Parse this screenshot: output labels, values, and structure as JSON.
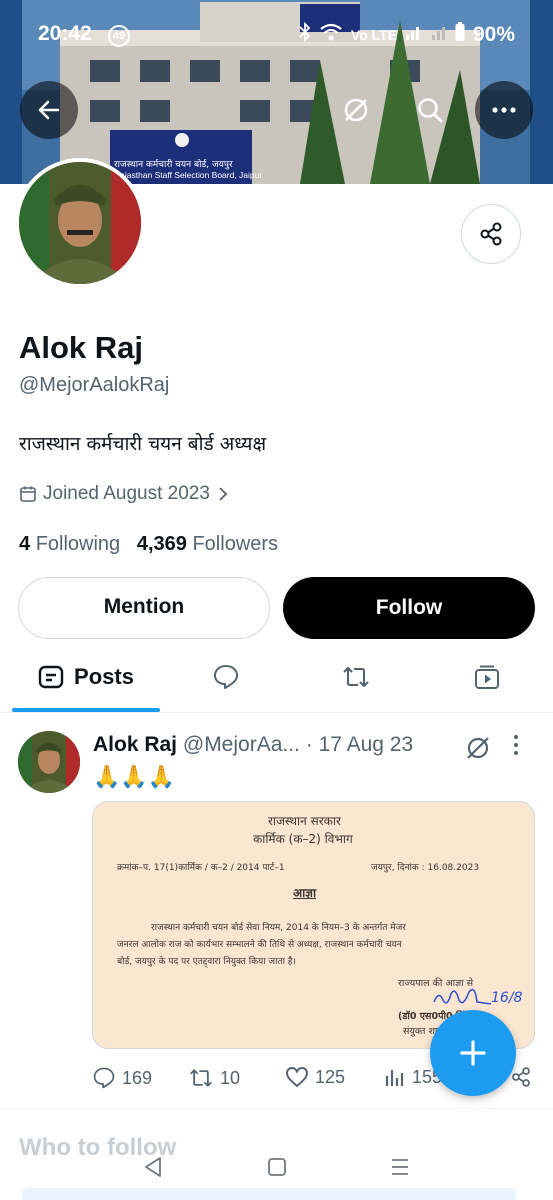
{
  "status_bar": {
    "time": "20:42",
    "notification_count": "49",
    "network": "Vo LTE",
    "battery": "90%"
  },
  "banner": {
    "sign_hindi": "राजस्थान कर्मचारी चयन बोर्ड, जयपुर",
    "sign_english": "Rajasthan Staff Selection Board, Jaipur"
  },
  "profile": {
    "name": "Alok Raj",
    "handle": "@MejorAalokRaj",
    "bio": "राजस्थान कर्मचारी चयन बोर्ड अध्यक्ष",
    "joined": "Joined August 2023",
    "following_count": "4",
    "following_label": "Following",
    "followers_count": "4,369",
    "followers_label": "Followers"
  },
  "buttons": {
    "mention": "Mention",
    "follow": "Follow"
  },
  "tabs": {
    "posts": "Posts"
  },
  "post": {
    "author": "Alok Raj",
    "handle_trunc": "@MejorAa...",
    "date": "· 17 Aug 23",
    "text": "🙏🙏🙏",
    "replies": "169",
    "reposts": "10",
    "likes": "125",
    "views": "155",
    "document": {
      "heading1": "राजस्थान सरकार",
      "heading2": "कार्मिक (क–2) विभाग",
      "ref": "क्रमांक–प. 17(1)कार्मिक / क–2 / 2014 पार्ट–1",
      "place_date": "जयपुर, दिनांक : 16.08.2023",
      "order_title": "आज्ञा",
      "line1": "राजस्थान कर्मचारी चयन बोर्ड सेवा नियम, 2014 के नियम–3 के अन्तर्गत मेजर",
      "line2": "जनरल आलोक राज को कार्यभार सम्भालने की तिथि से अध्यक्ष, राजस्थान कर्मचारी चयन",
      "line3": "बोर्ड, जयपुर के पद पर एतद्द्वारा नियुक्त किया जाता है।",
      "sign1": "राज्यपाल की आज्ञा से",
      "sign2": "(डॉ0 एस0पी0 सिंह)",
      "sign3": "संयुक्त शासन सचिव",
      "handwriting": "16/8"
    }
  },
  "who_to_follow": "Who to follow"
}
